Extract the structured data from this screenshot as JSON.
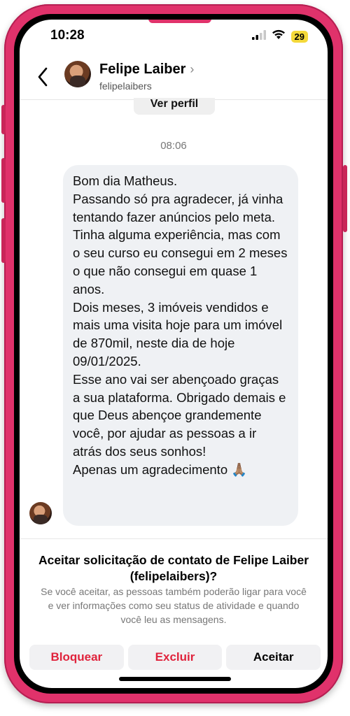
{
  "status_bar": {
    "time": "10:28",
    "battery": "29",
    "icons": [
      "cellular-signal-icon",
      "wifi-icon",
      "battery-icon"
    ]
  },
  "header": {
    "name": "Felipe Laiber",
    "handle": "felipelaibers",
    "back_icon": "back-arrow-icon",
    "chevron_icon": "chevron-right-icon"
  },
  "chat": {
    "view_profile_label": "Ver perfil",
    "timestamp": "08:06",
    "message_paragraphs": [
      "Bom dia Matheus.",
      "Passando só pra agradecer, já vinha tentando fazer anúncios pelo meta. Tinha alguma experiência, mas com o seu curso eu consegui em 2 meses o que não consegui em quase 1 anos.",
      "Dois meses, 3 imóveis vendidos e mais uma visita hoje para um imóvel de 870mil, neste dia de hoje 09/01/2025.",
      "Esse ano vai ser abençoado graças a sua plataforma. Obrigado demais e que Deus abençoe grandemente você, por ajudar as pessoas a ir atrás dos seus sonhos!",
      "Apenas um agradecimento 🙏🏽"
    ]
  },
  "request": {
    "title": "Aceitar solicitação de contato de Felipe Laiber (felipelaibers)?",
    "description": "Se você aceitar, as pessoas também poderão ligar para você e ver informações como seu status de atividade e quando você leu as mensagens.",
    "buttons": {
      "block": "Bloquear",
      "delete": "Excluir",
      "accept": "Aceitar"
    }
  },
  "colors": {
    "frame": "#e0326b",
    "bubble": "#eff1f4",
    "destructive": "#e0233c",
    "battery": "#f4d93a"
  }
}
